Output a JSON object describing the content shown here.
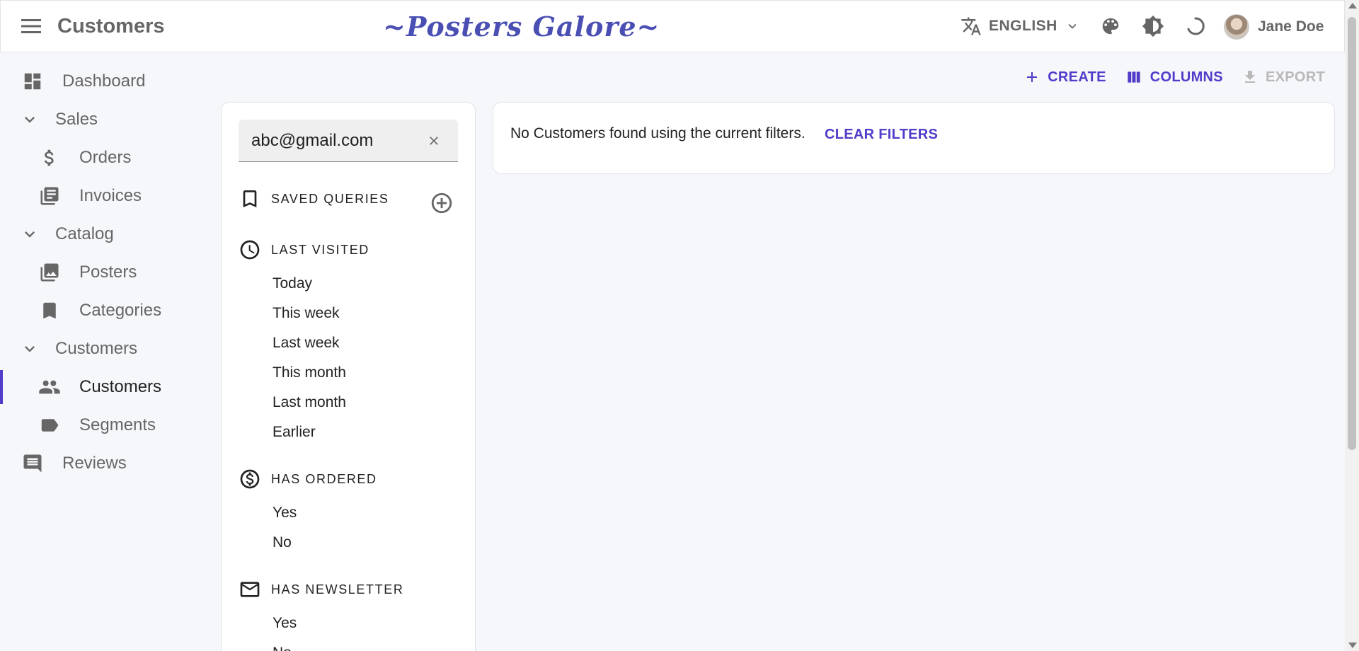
{
  "app_bar": {
    "title": "Customers",
    "brand": "~Posters Galore~",
    "language": "ENGLISH",
    "user_name": "Jane Doe"
  },
  "sidebar": {
    "items": [
      {
        "label": "Dashboard",
        "icon": "dashboard-icon"
      },
      {
        "label": "Sales",
        "icon": "chevron-down-icon"
      },
      {
        "label": "Orders",
        "icon": "dollar-icon"
      },
      {
        "label": "Invoices",
        "icon": "library-books-icon"
      },
      {
        "label": "Catalog",
        "icon": "chevron-down-icon"
      },
      {
        "label": "Posters",
        "icon": "collections-icon"
      },
      {
        "label": "Categories",
        "icon": "bookmark-icon"
      },
      {
        "label": "Customers",
        "icon": "chevron-down-icon"
      },
      {
        "label": "Customers",
        "icon": "people-icon",
        "active": true
      },
      {
        "label": "Segments",
        "icon": "label-icon"
      },
      {
        "label": "Reviews",
        "icon": "comment-icon"
      }
    ]
  },
  "toolbar": {
    "create_label": "CREATE",
    "columns_label": "COLUMNS",
    "export_label": "EXPORT"
  },
  "filters": {
    "search_value": "abc@gmail.com",
    "saved_queries_label": "SAVED QUERIES",
    "last_visited": {
      "title": "LAST VISITED",
      "options": [
        "Today",
        "This week",
        "Last week",
        "This month",
        "Last month",
        "Earlier"
      ]
    },
    "has_ordered": {
      "title": "HAS ORDERED",
      "options": [
        "Yes",
        "No"
      ]
    },
    "has_newsletter": {
      "title": "HAS NEWSLETTER",
      "options": [
        "Yes",
        "No"
      ]
    }
  },
  "results": {
    "empty_message": "No Customers found using the current filters.",
    "clear_filters_label": "CLEAR FILTERS"
  },
  "colors": {
    "accent": "#4f3cc9",
    "brand": "#4a4fb3",
    "icon_gray": "#666666"
  }
}
